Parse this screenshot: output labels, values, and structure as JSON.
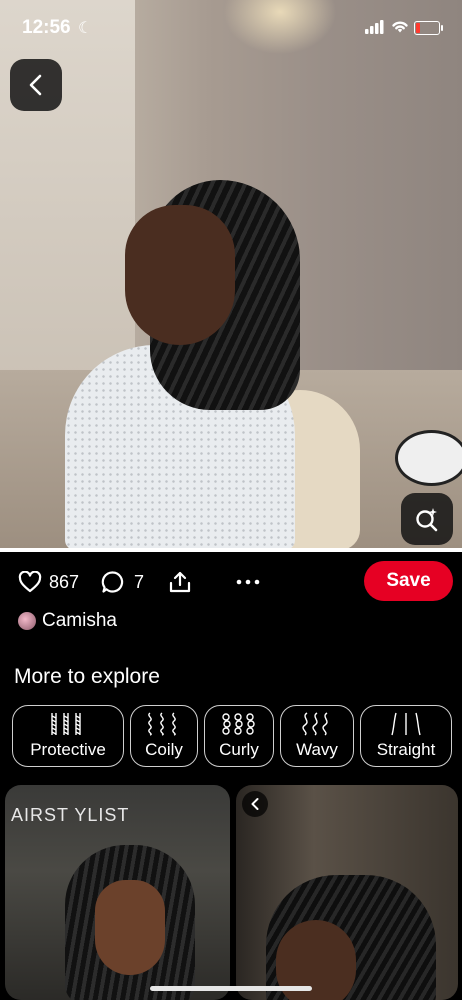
{
  "status_bar": {
    "time": "12:56"
  },
  "pin": {
    "likes": "867",
    "comments": "7",
    "save_label": "Save",
    "author": "Camisha"
  },
  "explore": {
    "title": "More to explore",
    "chips": [
      {
        "label": "Protective",
        "icon": "braids-icon"
      },
      {
        "label": "Coily",
        "icon": "coily-icon"
      },
      {
        "label": "Curly",
        "icon": "curly-icon"
      },
      {
        "label": "Wavy",
        "icon": "wavy-icon"
      },
      {
        "label": "Straight",
        "icon": "straight-icon"
      }
    ]
  },
  "cards": [
    {
      "overlay_text": "AIRST YLIST"
    },
    {
      "overlay_text": ""
    }
  ],
  "colors": {
    "save": "#e60023",
    "background": "#000000"
  }
}
